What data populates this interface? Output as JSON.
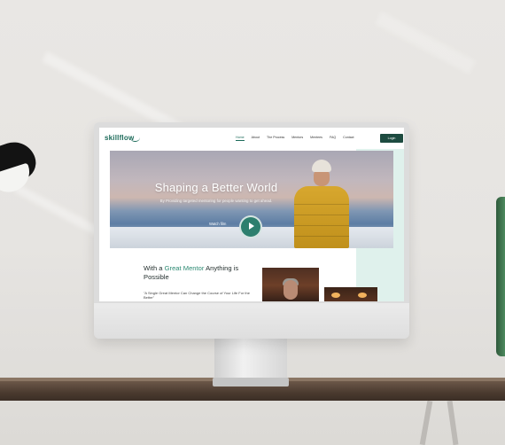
{
  "site": {
    "logo": "skillflow",
    "nav": {
      "items": [
        "Home",
        "About",
        "The Process",
        "Mentors",
        "Mentees",
        "FAQ",
        "Contact"
      ],
      "active": "Home",
      "login_label": "Login"
    },
    "hero": {
      "title": "Shaping a Better World",
      "subtitle": "By Providing targeted mentoring for people wanting to get ahead.",
      "watch_label": "Watch film"
    },
    "section": {
      "title_prefix": "With a ",
      "title_highlight": "Great Mentor",
      "title_suffix": " Anything is Possible",
      "subtitle": "\"A Single Great Mentor Can Change the Course of Your Life For the Better\""
    }
  },
  "colors": {
    "brand": "#1d6b5a",
    "button": "#1d4b40",
    "play": "#2d7f6e",
    "hero_panel": "#dff1ec"
  }
}
